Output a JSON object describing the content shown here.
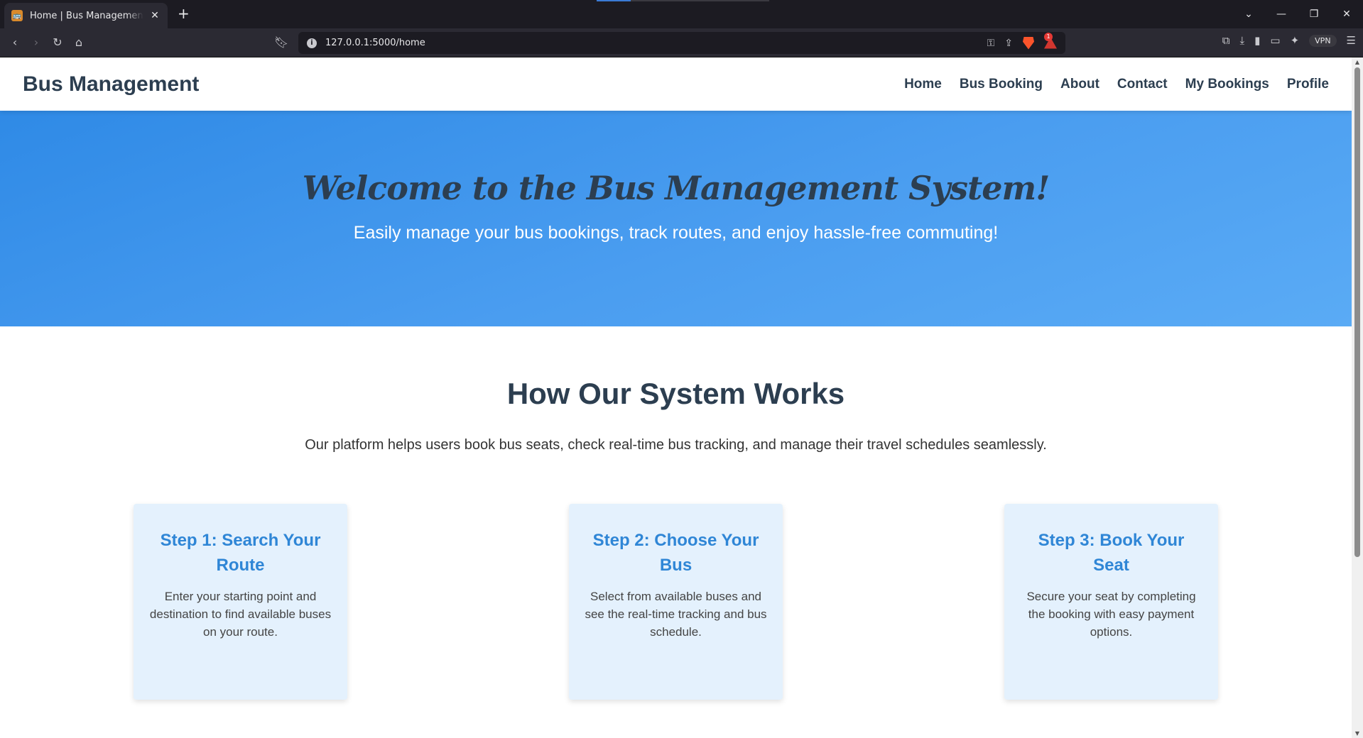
{
  "browser": {
    "tab_title": "Home | Bus Management System",
    "tab_close": "✕",
    "new_tab": "+",
    "url": "127.0.0.1:5000/home",
    "rewards_count": "1",
    "vpn_label": "VPN",
    "window_controls": {
      "list": "⌄",
      "minimize": "—",
      "restore": "❐",
      "close": "✕"
    }
  },
  "site": {
    "brand": "Bus Management",
    "nav": [
      "Home",
      "Bus Booking",
      "About",
      "Contact",
      "My Bookings",
      "Profile"
    ]
  },
  "hero": {
    "title": "Welcome to the Bus Management System!",
    "subtitle": "Easily manage your bus bookings, track routes, and enjoy hassle-free commuting!"
  },
  "works": {
    "title": "How Our System Works",
    "description": "Our platform helps users book bus seats, check real-time bus tracking, and manage their travel schedules seamlessly.",
    "steps": [
      {
        "title": "Step 1: Search Your Route",
        "text": "Enter your starting point and destination to find available buses on your route."
      },
      {
        "title": "Step 2: Choose Your Bus",
        "text": "Select from available buses and see the real-time tracking and bus schedule."
      },
      {
        "title": "Step 3: Book Your Seat",
        "text": "Secure your seat by completing the booking with easy payment options."
      }
    ]
  },
  "colors": {
    "brand_dark": "#2c3e50",
    "hero_blue": "#3a93ec",
    "card_bg": "#e4f1fd",
    "card_title": "#2f86d6"
  },
  "icons": {
    "back": "back-icon",
    "forward": "forward-icon",
    "reload": "reload-icon",
    "home": "home-icon",
    "bookmark": "bookmark-icon",
    "site_info": "info-icon",
    "key": "key-icon",
    "share": "share-icon",
    "brave_shields": "brave-shields-icon",
    "brave_rewards": "brave-rewards-icon",
    "extensions": "extensions-icon",
    "downloads": "download-icon",
    "sidebar": "sidebar-icon",
    "wallet": "wallet-icon",
    "leo": "leo-ai-icon",
    "menu": "menu-icon"
  }
}
